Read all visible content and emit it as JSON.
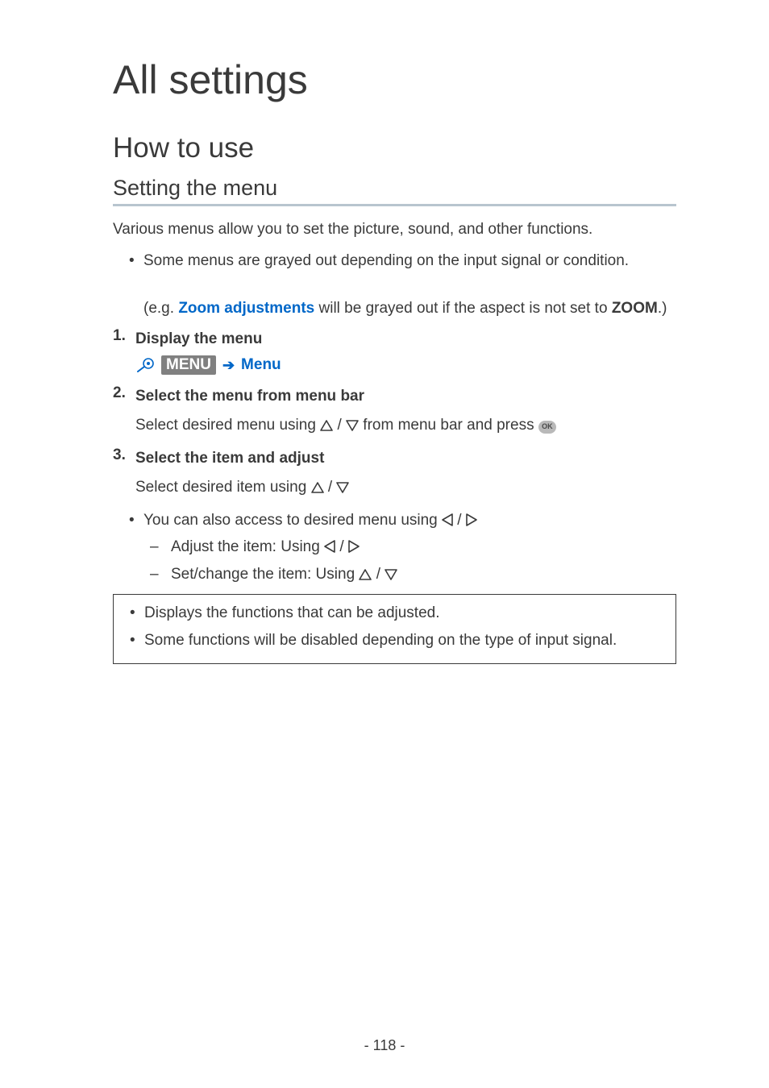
{
  "title": "All settings",
  "section": "How to use",
  "subsection": "Setting the menu",
  "intro": "Various menus allow you to set the picture, sound, and other functions.",
  "note1": {
    "lead": "Some menus are grayed out depending on the input signal or condition.",
    "paren_pre": "(e.g. ",
    "link": "Zoom adjustments",
    "paren_mid": " will be grayed out if the aspect is not set to ",
    "zoom": "ZOOM",
    "paren_post": ".)"
  },
  "steps": [
    {
      "title": "Display the menu",
      "menu_chip": "MENU",
      "menu_target": "Menu"
    },
    {
      "title": "Select the menu from menu bar",
      "body_pre": "Select desired menu using ",
      "body_mid": " from menu bar and press "
    },
    {
      "title": "Select the item and adjust",
      "body_pre": "Select desired item using "
    }
  ],
  "sub_bullet": {
    "pre": "You can also access to desired menu using "
  },
  "dashes": [
    {
      "pre": "Adjust the item: Using "
    },
    {
      "pre": "Set/change the item: Using "
    }
  ],
  "info_box": [
    "Displays the functions that can be adjusted.",
    "Some functions will be disabled depending on the type of input signal."
  ],
  "glyphs": {
    "slash": " / ",
    "ok": "OK",
    "bullet": "•",
    "dash": "–",
    "arrow": "➔"
  },
  "page_number": "- 118 -"
}
